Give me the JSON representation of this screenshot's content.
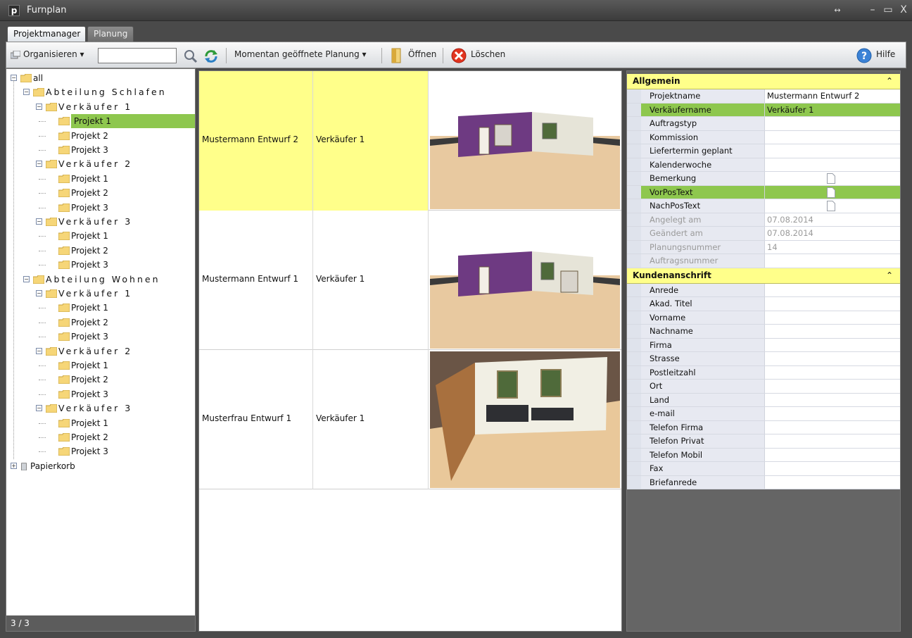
{
  "window": {
    "title": "Furnplan",
    "app_icon_letter": "p",
    "controls": [
      "↔",
      "–",
      "▭",
      "X"
    ]
  },
  "tabs": [
    {
      "label": "Projektmanager",
      "active": true
    },
    {
      "label": "Planung",
      "active": false
    }
  ],
  "toolbar": {
    "organize_label": "Organisieren",
    "search_value": "",
    "open_planning_label": "Momentan geöffnete Planung",
    "open_label": "Öffnen",
    "delete_label": "Löschen",
    "help_label": "Hilfe"
  },
  "tree": {
    "root": "all",
    "departments": [
      {
        "label": "Abteilung Schlafen",
        "sellers": [
          {
            "label": "Verkäufer 1",
            "projects": [
              "Projekt 1",
              "Projekt 2",
              "Projekt 3"
            ]
          },
          {
            "label": "Verkäufer 2",
            "projects": [
              "Projekt 1",
              "Projekt 2",
              "Projekt 3"
            ]
          },
          {
            "label": "Verkäufer 3",
            "projects": [
              "Projekt 1",
              "Projekt 2",
              "Projekt 3"
            ]
          }
        ]
      },
      {
        "label": "Abteilung Wohnen",
        "sellers": [
          {
            "label": "Verkäufer 1",
            "projects": [
              "Projekt 1",
              "Projekt 2",
              "Projekt 3"
            ]
          },
          {
            "label": "Verkäufer 2",
            "projects": [
              "Projekt 1",
              "Projekt 2",
              "Projekt 3"
            ]
          },
          {
            "label": "Verkäufer 3",
            "projects": [
              "Projekt 1",
              "Projekt 2",
              "Projekt 3"
            ]
          }
        ]
      }
    ],
    "trash": "Papierkorb",
    "status": "3 / 3"
  },
  "projects": [
    {
      "name": "Mustermann Entwurf 2",
      "seller": "Verkäufer 1",
      "selected": true
    },
    {
      "name": "Mustermann Entwurf 1",
      "seller": "Verkäufer 1",
      "selected": false
    },
    {
      "name": "Musterfrau Entwurf 1",
      "seller": "Verkäufer 1",
      "selected": false
    }
  ],
  "properties": {
    "general_title": "Allgemein",
    "general": [
      {
        "name": "Projektname",
        "value": "Mustermann Entwurf 2"
      },
      {
        "name": "Verkäufername",
        "value": "Verkäufer 1",
        "highlight": true
      },
      {
        "name": "Auftragstyp",
        "value": ""
      },
      {
        "name": "Kommission",
        "value": ""
      },
      {
        "name": "Liefertermin geplant",
        "value": ""
      },
      {
        "name": "Kalenderwoche",
        "value": ""
      },
      {
        "name": "Bemerkung",
        "value": "",
        "doc": true
      },
      {
        "name": "VorPosText",
        "value": "",
        "doc": true,
        "highlight": true
      },
      {
        "name": "NachPosText",
        "value": "",
        "doc": true
      },
      {
        "name": "Angelegt am",
        "value": "07.08.2014",
        "readonly": true
      },
      {
        "name": "Geändert am",
        "value": "07.08.2014",
        "readonly": true
      },
      {
        "name": "Planungsnummer",
        "value": "14",
        "readonly": true
      },
      {
        "name": "Auftragsnummer",
        "value": "",
        "readonly": true
      }
    ],
    "address_title": "Kundenanschrift",
    "address": [
      {
        "name": "Anrede",
        "value": ""
      },
      {
        "name": "Akad. Titel",
        "value": ""
      },
      {
        "name": "Vorname",
        "value": ""
      },
      {
        "name": "Nachname",
        "value": ""
      },
      {
        "name": "Firma",
        "value": ""
      },
      {
        "name": "Strasse",
        "value": ""
      },
      {
        "name": "Postleitzahl",
        "value": ""
      },
      {
        "name": "Ort",
        "value": ""
      },
      {
        "name": "Land",
        "value": ""
      },
      {
        "name": "e-mail",
        "value": ""
      },
      {
        "name": "Telefon Firma",
        "value": ""
      },
      {
        "name": "Telefon Privat",
        "value": ""
      },
      {
        "name": "Telefon Mobil",
        "value": ""
      },
      {
        "name": "Fax",
        "value": ""
      },
      {
        "name": "Briefanrede",
        "value": ""
      }
    ]
  },
  "colors": {
    "selection_green": "#8ec74e",
    "highlight_yellow": "#ffff8a"
  }
}
